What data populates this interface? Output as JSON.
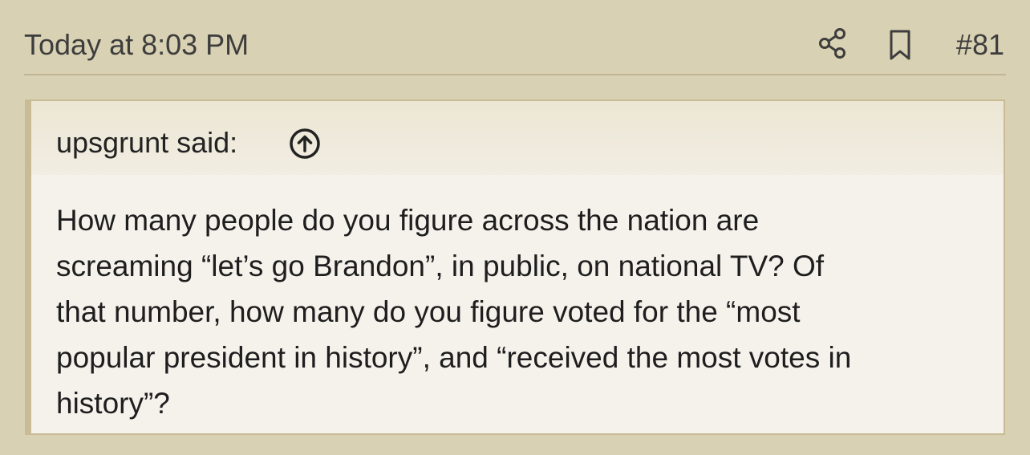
{
  "post": {
    "date": "Today at 8:03 PM",
    "number": "#81",
    "icons": {
      "share": "share-icon",
      "bookmark": "bookmark-icon"
    }
  },
  "quote": {
    "author_label": "upsgrunt said:",
    "jump_icon": "arrow-up-circle-icon",
    "text": "How many people do you figure across the nation are\nscreaming “let’s go Brandon”, in public, on national TV? Of\nthat number, how many do you figure voted for the “most\npopular president in history”, and “received the most votes in\nhistory”?"
  },
  "colors": {
    "background": "#d9d1b3",
    "quote_border": "#c8bb95",
    "quote_body_bg": "#f5f2ec"
  }
}
